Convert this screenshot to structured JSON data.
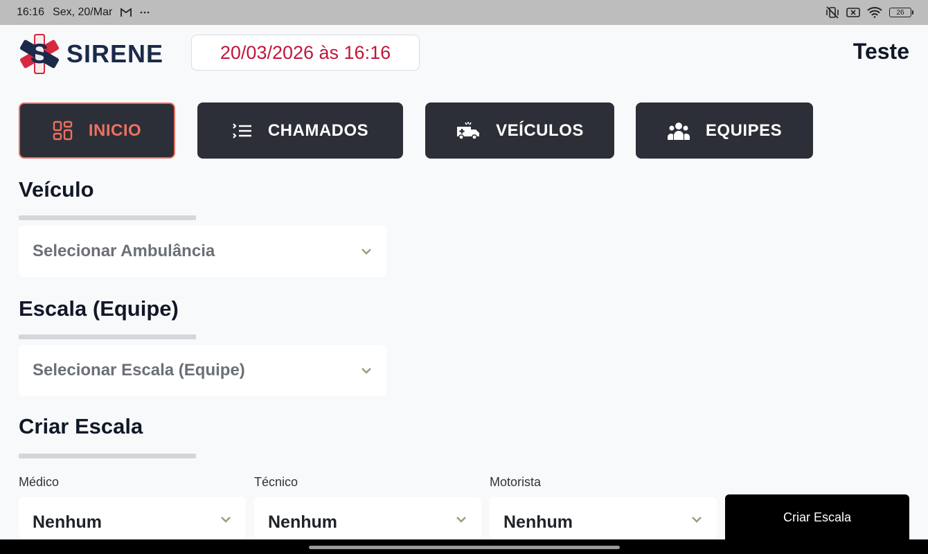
{
  "status_bar": {
    "time": "16:16",
    "date": "Sex, 20/Mar",
    "battery": "26"
  },
  "header": {
    "logo_text": "SIRENE",
    "datetime": "20/03/2026 às 16:16",
    "user_name": "Teste"
  },
  "nav": {
    "items": [
      {
        "label": "INICIO",
        "icon": "grid-icon"
      },
      {
        "label": "CHAMADOS",
        "icon": "list-icon"
      },
      {
        "label": "VEÍCULOS",
        "icon": "ambulance-icon"
      },
      {
        "label": "EQUIPES",
        "icon": "team-icon"
      }
    ],
    "active": "INICIO"
  },
  "sections": {
    "vehicle": {
      "title": "Veículo",
      "placeholder": "Selecionar Ambulância"
    },
    "team_scale": {
      "title": "Escala (Equipe)",
      "placeholder": "Selecionar Escala (Equipe)"
    },
    "create_scale": {
      "title": "Criar Escala",
      "fields": [
        {
          "label": "Médico",
          "value": "Nenhum"
        },
        {
          "label": "Técnico",
          "value": "Nenhum"
        },
        {
          "label": "Motorista",
          "value": "Nenhum"
        }
      ],
      "button_label": "Criar Escala"
    }
  },
  "colors": {
    "accent_red": "#c0163a",
    "active_nav": "#f07060",
    "nav_bg": "#2c2f37",
    "brand_navy": "#1b2a4a"
  }
}
